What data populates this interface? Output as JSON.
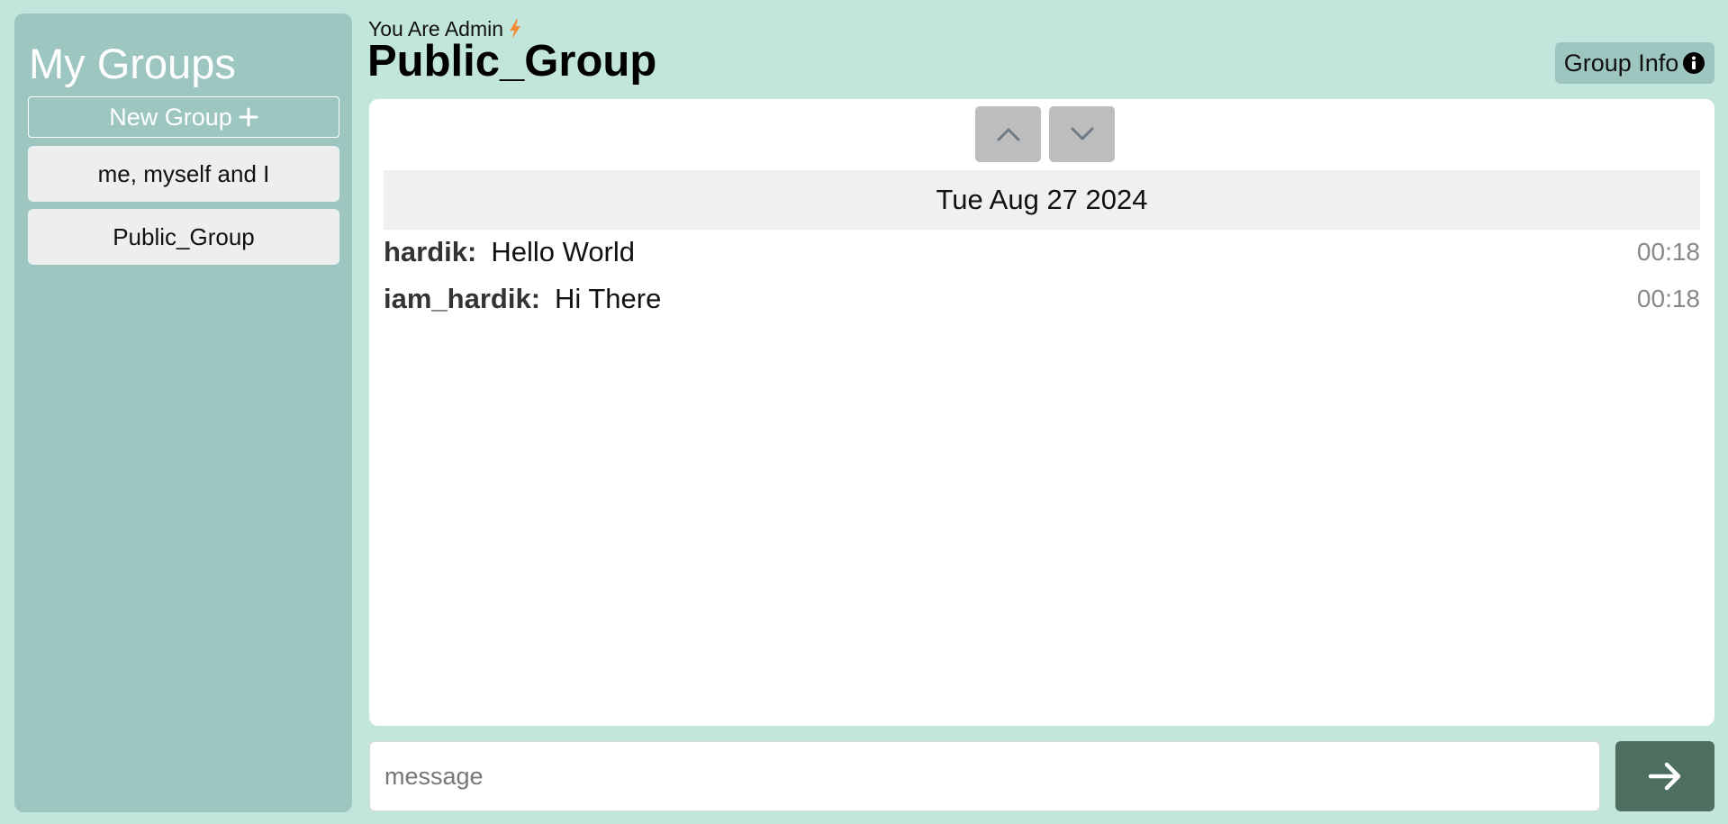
{
  "sidebar": {
    "title": "My Groups",
    "new_group_label": "New Group",
    "groups": [
      {
        "label": "me, myself and I"
      },
      {
        "label": "Public_Group"
      }
    ]
  },
  "header": {
    "admin_label": "You Are Admin",
    "group_title": "Public_Group",
    "group_info_label": "Group Info"
  },
  "chat": {
    "date": "Tue Aug 27 2024",
    "messages": [
      {
        "sender": "hardik:",
        "text": "Hello World",
        "time": "00:18"
      },
      {
        "sender": "iam_hardik:",
        "text": "Hi There",
        "time": "00:18"
      }
    ]
  },
  "composer": {
    "placeholder": "message",
    "value": ""
  },
  "icons": {
    "new_group": "plus-icon",
    "admin": "lightning-bolt-icon",
    "group_info": "info-circle-icon",
    "scroll_up": "chevron-up-icon",
    "scroll_down": "chevron-down-icon",
    "send": "arrow-right-icon"
  },
  "colors": {
    "background": "#c2e6db",
    "sidebar": "#9dc6c1",
    "admin_bolt": "#f28c38",
    "send_button": "#4e6e60",
    "scroll_button": "#bdbdbd",
    "date_bar": "#f0f0f0"
  }
}
